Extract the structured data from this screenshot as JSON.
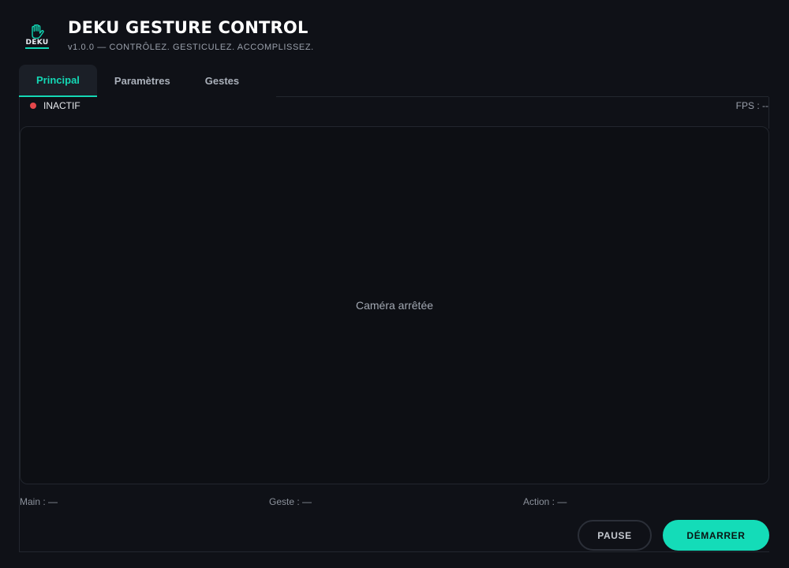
{
  "header": {
    "logo_text": "DEKU",
    "title": "DEKU GESTURE CONTROL",
    "subtitle": "v1.0.0 — CONTRÔLEZ. GESTICULEZ. ACCOMPLISSEZ."
  },
  "tabs": [
    {
      "label": "Principal",
      "active": true
    },
    {
      "label": "Paramètres",
      "active": false
    },
    {
      "label": "Gestes",
      "active": false
    }
  ],
  "status": {
    "label": "INACTIF",
    "color": "#e5474b"
  },
  "fps": "FPS : --",
  "camera": {
    "message": "Caméra arrêtée"
  },
  "info": {
    "hand": "Main : —",
    "gesture": "Geste : —",
    "action": "Action : —"
  },
  "buttons": {
    "pause": "PAUSE",
    "start": "DÉMARRER"
  },
  "colors": {
    "accent": "#14dcb8",
    "background": "#0f1117",
    "status_inactive": "#e5474b"
  }
}
